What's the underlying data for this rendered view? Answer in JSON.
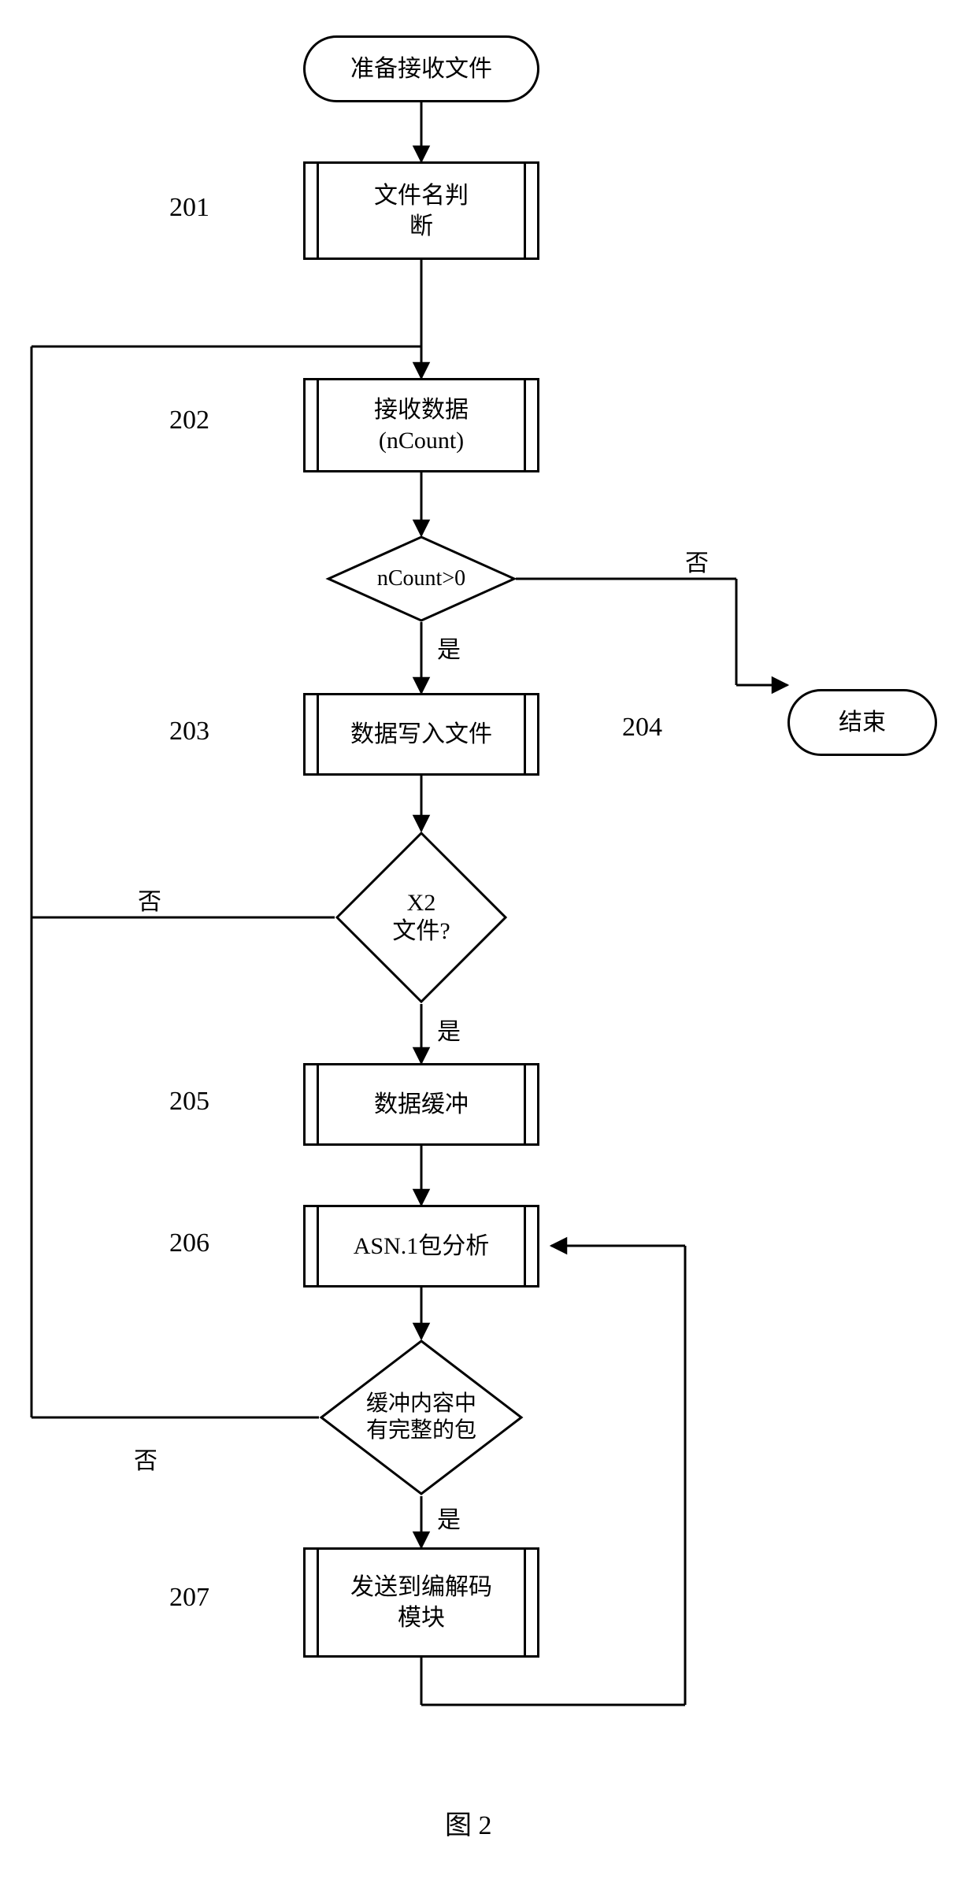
{
  "terminator_start": "准备接收文件",
  "terminator_end": "结束",
  "steps": {
    "s201": {
      "num": "201",
      "text": "文件名判\n断"
    },
    "s202": {
      "num": "202",
      "text": "接收数据\n(nCount)"
    },
    "s203": {
      "num": "203",
      "text": "数据写入文件"
    },
    "s204": {
      "num": "204"
    },
    "s205": {
      "num": "205",
      "text": "数据缓冲"
    },
    "s206": {
      "num": "206",
      "text": "ASN.1包分析"
    },
    "s207": {
      "num": "207",
      "text": "发送到编解码\n模块"
    }
  },
  "decisions": {
    "d1": "nCount>0",
    "d2": "X2\n文件?",
    "d3": "缓冲内容中\n有完整的包"
  },
  "labels": {
    "yes": "是",
    "no": "否"
  },
  "caption": "图 2",
  "chart_data": {
    "type": "flowchart",
    "title": "图 2",
    "nodes": [
      {
        "id": "start",
        "kind": "terminator",
        "text": "准备接收文件"
      },
      {
        "id": "201",
        "kind": "predefined-process",
        "text": "文件名判断"
      },
      {
        "id": "202",
        "kind": "predefined-process",
        "text": "接收数据 (nCount)"
      },
      {
        "id": "d1",
        "kind": "decision",
        "text": "nCount>0"
      },
      {
        "id": "203",
        "kind": "predefined-process",
        "text": "数据写入文件"
      },
      {
        "id": "204",
        "kind": "terminator",
        "text": "结束"
      },
      {
        "id": "d2",
        "kind": "decision",
        "text": "X2 文件?"
      },
      {
        "id": "205",
        "kind": "predefined-process",
        "text": "数据缓冲"
      },
      {
        "id": "206",
        "kind": "predefined-process",
        "text": "ASN.1包分析"
      },
      {
        "id": "d3",
        "kind": "decision",
        "text": "缓冲内容中有完整的包"
      },
      {
        "id": "207",
        "kind": "predefined-process",
        "text": "发送到编解码模块"
      }
    ],
    "edges": [
      {
        "from": "start",
        "to": "201"
      },
      {
        "from": "201",
        "to": "202"
      },
      {
        "from": "202",
        "to": "d1"
      },
      {
        "from": "d1",
        "to": "203",
        "label": "是"
      },
      {
        "from": "d1",
        "to": "204",
        "label": "否"
      },
      {
        "from": "203",
        "to": "d2"
      },
      {
        "from": "d2",
        "to": "205",
        "label": "是"
      },
      {
        "from": "d2",
        "to": "202",
        "label": "否"
      },
      {
        "from": "205",
        "to": "206"
      },
      {
        "from": "206",
        "to": "d3"
      },
      {
        "from": "d3",
        "to": "207",
        "label": "是"
      },
      {
        "from": "d3",
        "to": "202",
        "label": "否"
      },
      {
        "from": "207",
        "to": "206"
      }
    ]
  }
}
